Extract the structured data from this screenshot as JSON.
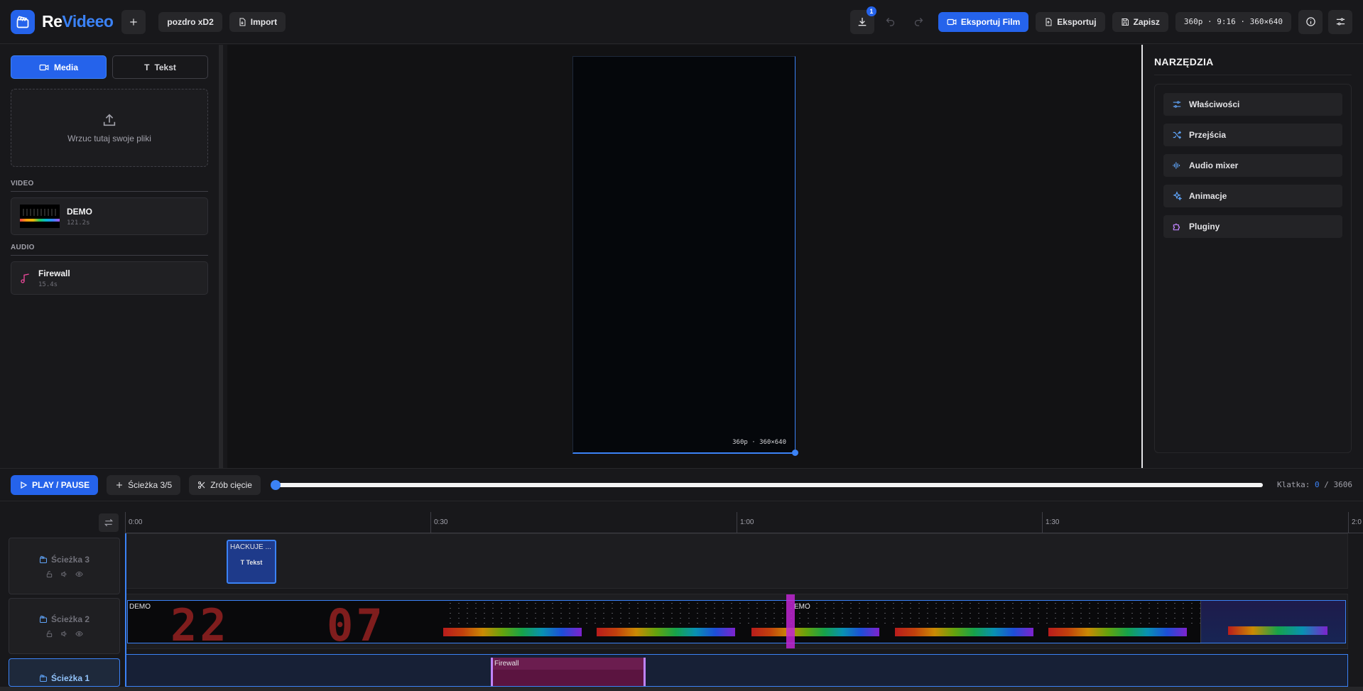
{
  "app": {
    "brand_re": "Re",
    "brand_videeo": "Videeo",
    "project_name": "pozdro xD2",
    "import_label": "Import",
    "download_badge": "1",
    "export_film_label": "Eksportuj Film",
    "export_label": "Eksportuj",
    "save_label": "Zapisz",
    "format_info": "360p · 9:16 · 360×640"
  },
  "left_panel": {
    "tabs": [
      {
        "label": "Media",
        "active": true
      },
      {
        "label": "Tekst",
        "active": false
      }
    ],
    "dropzone_text": "Wrzuc tutaj swoje pliki",
    "video_section": "VIDEO",
    "video_items": [
      {
        "name": "DEMO",
        "duration": "121.2s"
      }
    ],
    "audio_section": "AUDIO",
    "audio_items": [
      {
        "name": "Firewall",
        "duration": "15.4s"
      }
    ]
  },
  "preview": {
    "canvas_label": "360p · 360×640"
  },
  "tools": {
    "title": "NARZĘDZIA",
    "items": [
      {
        "label": "Właściwości",
        "icon": "sliders-icon"
      },
      {
        "label": "Przejścia",
        "icon": "shuffle-icon"
      },
      {
        "label": "Audio mixer",
        "icon": "audio-waveform-icon"
      },
      {
        "label": "Animacje",
        "icon": "sparkles-icon"
      },
      {
        "label": "Pluginy",
        "icon": "puzzle-icon"
      }
    ]
  },
  "controls": {
    "play_label": "PLAY / PAUSE",
    "track_label": "Ścieżka 3/5",
    "cut_label": "Zrób cięcie",
    "frame_label": "Klatka:",
    "frame_current": "0",
    "frame_total": "/ 3606",
    "progress": 0
  },
  "timeline": {
    "ticks": [
      "0:00",
      "0:30",
      "1:00",
      "1:30",
      "2:0"
    ],
    "tracks": [
      {
        "name": "Ścieżka 3",
        "active": false
      },
      {
        "name": "Ścieżka 2",
        "active": false
      },
      {
        "name": "Ścieżka 1",
        "active": true
      }
    ],
    "text_clip": {
      "title": "HACKUJE ...",
      "label": "Tekst"
    },
    "video_clip_1": "DEMO",
    "video_clip_2": "EMO",
    "digits": [
      "22",
      "07"
    ],
    "audio_clip": "Firewall"
  },
  "colors": {
    "accent": "#2563eb",
    "audio_clip": "#5b1440",
    "audio_border": "#c084fc",
    "text_clip": "#1e3a8a"
  }
}
